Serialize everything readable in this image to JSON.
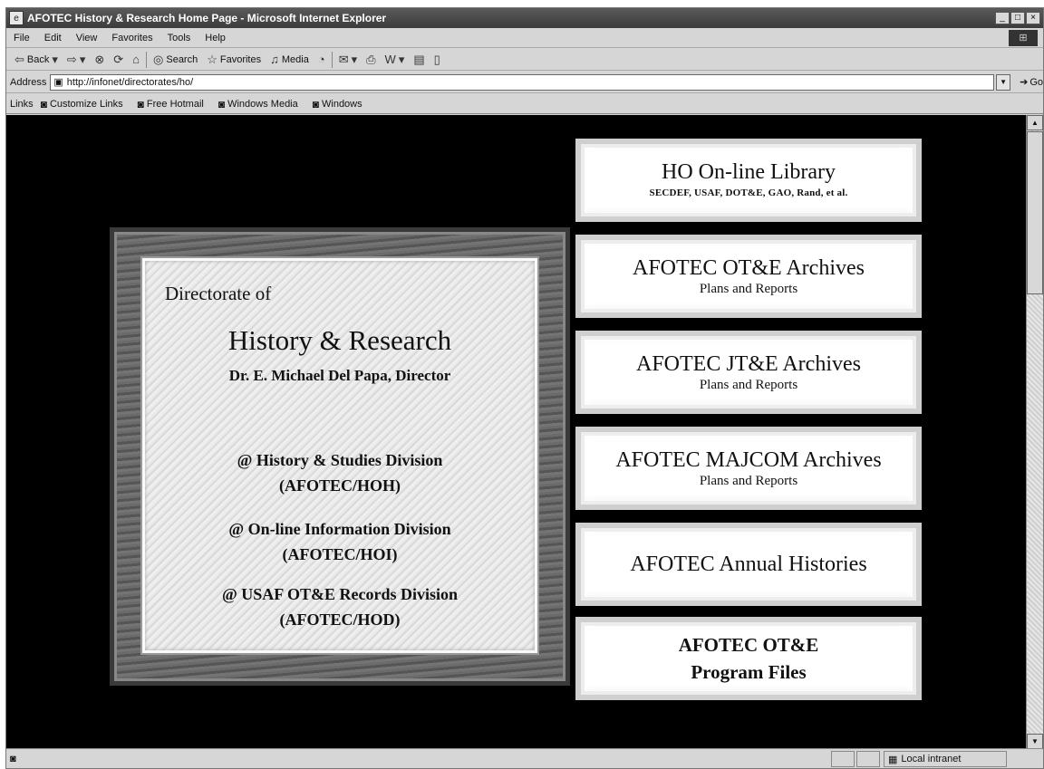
{
  "window": {
    "title": "AFOTEC History & Research Home Page - Microsoft Internet Explorer",
    "controls": [
      "_",
      "□",
      "×"
    ]
  },
  "menu": [
    "File",
    "Edit",
    "View",
    "Favorites",
    "Tools",
    "Help"
  ],
  "toolbar": {
    "back": "Back",
    "search": "Search",
    "favorites": "Favorites",
    "media": "Media"
  },
  "address": {
    "label": "Address",
    "url": "http://infonet/directorates/ho/",
    "go": "Go"
  },
  "links": {
    "label": "Links",
    "items": [
      "Customize Links",
      "Free Hotmail",
      "Windows Media",
      "Windows"
    ]
  },
  "plaque": {
    "directorate_of": "Directorate of",
    "title": "History & Research",
    "director": "Dr. E. Michael Del Papa, Director",
    "divisions": [
      {
        "name": "@ History & Studies Division",
        "code": "(AFOTEC/HOH)"
      },
      {
        "name": "@ On-line Information Division",
        "code": "(AFOTEC/HOI)"
      },
      {
        "name": "@ USAF OT&E Records Division",
        "code": "(AFOTEC/HOD)"
      }
    ]
  },
  "nav": [
    {
      "title": "HO On-line Library",
      "subtitle": "SECDEF, USAF, DOT&E, GAO, Rand, et al."
    },
    {
      "title": "AFOTEC OT&E Archives",
      "subtitle": "Plans and Reports"
    },
    {
      "title": "AFOTEC JT&E Archives",
      "subtitle": "Plans and Reports"
    },
    {
      "title": "AFOTEC MAJCOM Archives",
      "subtitle": "Plans and Reports"
    },
    {
      "title": "AFOTEC Annual Histories",
      "subtitle": ""
    },
    {
      "title": "AFOTEC OT&E",
      "subtitle": "Program Files"
    }
  ],
  "status": {
    "zone": "Local intranet"
  }
}
